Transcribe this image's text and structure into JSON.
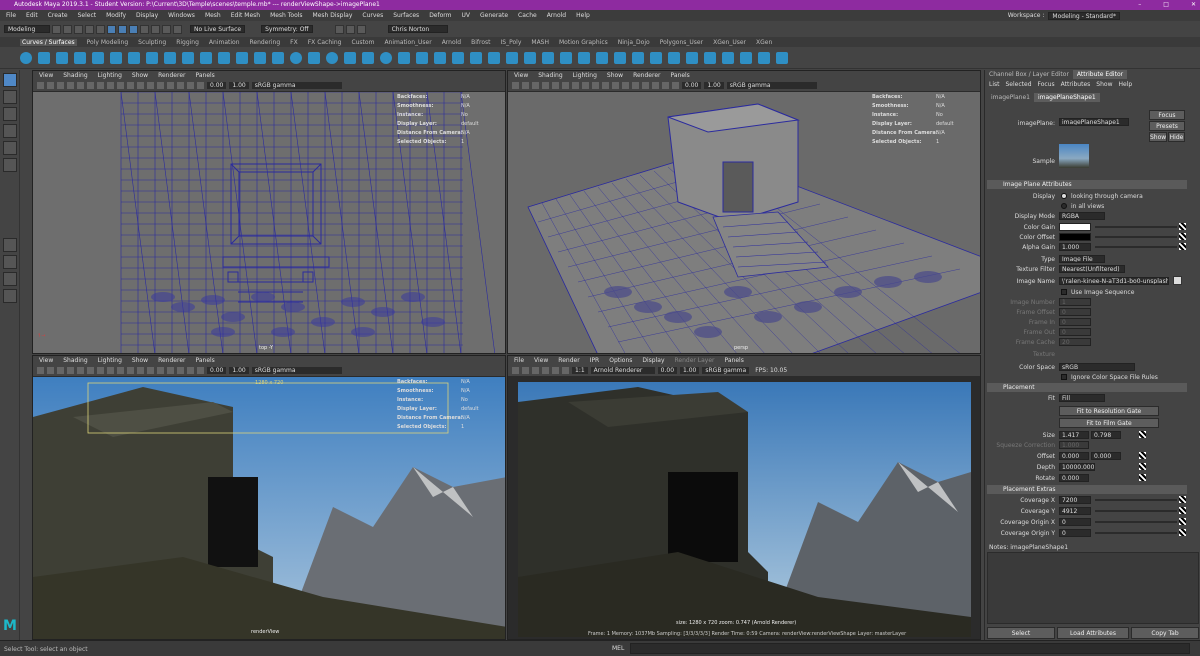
{
  "title": "Autodesk Maya 2019.3.1 - Student Version: P:\\Current\\3D\\Temple\\scenes\\temple.mb* --- renderViewShape->imagePlane1",
  "menus": [
    "File",
    "Edit",
    "Create",
    "Select",
    "Modify",
    "Display",
    "Windows",
    "Mesh",
    "Edit Mesh",
    "Mesh Tools",
    "Mesh Display",
    "Curves",
    "Surfaces",
    "Deform",
    "UV",
    "Generate",
    "Cache",
    "Arnold",
    "Help"
  ],
  "workspace_label": "Workspace :",
  "workspace_value": "Modeling - Standard*",
  "mode_menu": "Modeling",
  "no_live_surface": "No Live Surface",
  "symmetry": "Symmetry: Off",
  "user": "Chris Norton",
  "shelf_tabs": [
    "Curves / Surfaces",
    "Poly Modeling",
    "Sculpting",
    "Rigging",
    "Animation",
    "Rendering",
    "FX",
    "FX Caching",
    "Custom",
    "Animation_User",
    "Arnold",
    "Bifrost",
    "IS_Poly",
    "MASH",
    "Motion Graphics",
    "Ninja_Dojo",
    "Polygons_User",
    "XGen_User",
    "XGen"
  ],
  "viewport_menu": [
    "View",
    "Shading",
    "Lighting",
    "Show",
    "Renderer",
    "Panels"
  ],
  "vp_val_a": "0.00",
  "vp_val_b": "1.00",
  "vp_gamma": "sRGB gamma",
  "hud_keys": [
    "Backfaces:",
    "Smoothness:",
    "Instance:",
    "Display Layer:",
    "Distance From Camera:",
    "Selected Objects:"
  ],
  "hud_vals_top": [
    "N/A",
    "N/A",
    "No",
    "default",
    "N/A",
    "1"
  ],
  "hud_vals_persp": [
    "N/A",
    "N/A",
    "No",
    "default",
    "N/A",
    "1"
  ],
  "hud_vals_bl": [
    "N/A",
    "N/A",
    "No",
    "default",
    "N/A",
    "1"
  ],
  "label_top": "top -Y",
  "label_persp": "persp",
  "label_rv": "renderView",
  "res_gate": "1280 x 720",
  "render_menu": [
    "File",
    "View",
    "Render",
    "IPR",
    "Options",
    "Display",
    "Render Layer",
    "Panels"
  ],
  "renderer": "Arnold Renderer",
  "rv_val_a": "0.00",
  "rv_val_b": "1.00",
  "rv_gamma": "sRGB gamma",
  "rv_one": "1:1",
  "rv_fps": "FPS: 10.05",
  "render_size_info": "size: 1280 x 720  zoom: 0.747        (Arnold Renderer)",
  "render_status": "Frame: 1    Memory: 1037Mb    Sampling: [3/3/3/3/3]    Render Time: 0:59    Camera: renderView:renderViewShape    Layer: masterLayer",
  "attr": {
    "panel_tabs": [
      "Channel Box / Layer Editor",
      "Attribute Editor"
    ],
    "menu": [
      "List",
      "Selected",
      "Focus",
      "Attributes",
      "Show",
      "Help"
    ],
    "node_tabs": [
      "imagePlane1",
      "imagePlaneShape1"
    ],
    "node_label": "imagePlane:",
    "node_value": "imagePlaneShape1",
    "focus": "Focus",
    "presets": "Presets",
    "show": "Show",
    "hide": "Hide",
    "sample": "Sample",
    "sec_attrs": "Image Plane Attributes",
    "display_label": "Display",
    "opt1": "looking through camera",
    "opt2": "in all views",
    "display_mode_label": "Display Mode",
    "display_mode": "RGBA",
    "color_gain": "Color Gain",
    "color_offset": "Color Offset",
    "alpha_gain": "Alpha Gain",
    "alpha_gain_val": "1.000",
    "type_label": "Type",
    "type_val": "Image File",
    "filter_label": "Texture Filter",
    "filter_val": "Nearest(Unfiltered)",
    "image_name_label": "Image Name",
    "image_name": "\\'ralen-kinee-N-aT3d1-bo0-unsplash.jpg",
    "use_seq": "Use Image Sequence",
    "dim_labels": [
      "Image Number",
      "Frame Offset",
      "Frame In",
      "Frame Out",
      "Frame Cache"
    ],
    "dim_vals": [
      "1",
      "0",
      "0",
      "0",
      "20"
    ],
    "texture": "Texture",
    "color_space_label": "Color Space",
    "color_space": "sRGB",
    "ignore_cs": "Ignore Color Space File Rules",
    "sec_place": "Placement",
    "fit_label": "Fit",
    "fit_val": "Fill",
    "fit_res": "Fit to Resolution Gate",
    "fit_film": "Fit to Film Gate",
    "size_label": "Size",
    "size_a": "1.417",
    "size_b": "0.798",
    "squeeze": "Squeeze Correction",
    "squeeze_val": "1.000",
    "offset_label": "Offset",
    "offset_a": "0.000",
    "offset_b": "0.000",
    "depth_label": "Depth",
    "depth_val": "10000.000",
    "rotate_label": "Rotate",
    "rotate_val": "0.000",
    "sec_extras": "Placement Extras",
    "cov_x": "Coverage X",
    "cov_x_val": "7200",
    "cov_y": "Coverage Y",
    "cov_y_val": "4912",
    "cov_ox": "Coverage Origin X",
    "cov_ox_val": "0",
    "cov_oy": "Coverage Origin Y",
    "cov_oy_val": "0",
    "notes": "Notes:  imagePlaneShape1",
    "select": "Select",
    "load": "Load Attributes",
    "copy": "Copy Tab"
  },
  "cmd_label": "MEL",
  "help_line": "Select Tool: select an object",
  "colors": {
    "titlebar": "#8e2ba0",
    "wire": "#2b2b9e",
    "sky": "#3f7fc0"
  }
}
